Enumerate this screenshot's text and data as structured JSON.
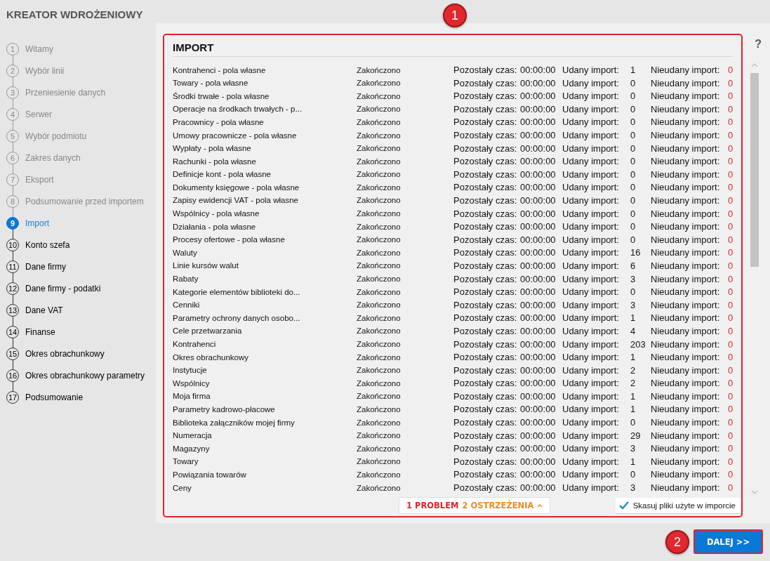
{
  "window": {
    "title": "KREATOR WDROŻENIOWY"
  },
  "steps": [
    {
      "number": "1",
      "label": "Witamy",
      "completed": true,
      "selected": false
    },
    {
      "number": "2",
      "label": "Wybór linii",
      "completed": true,
      "selected": false
    },
    {
      "number": "3",
      "label": "Przeniesienie danych",
      "completed": true,
      "selected": false
    },
    {
      "number": "4",
      "label": "Serwer",
      "completed": true,
      "selected": false
    },
    {
      "number": "5",
      "label": "Wybór podmiotu",
      "completed": true,
      "selected": false
    },
    {
      "number": "6",
      "label": "Zakres danych",
      "completed": true,
      "selected": false
    },
    {
      "number": "7",
      "label": "Eksport",
      "completed": true,
      "selected": false
    },
    {
      "number": "8",
      "label": "Podsumowanie przed importem",
      "completed": true,
      "selected": false
    },
    {
      "number": "9",
      "label": "Import",
      "completed": false,
      "selected": true
    },
    {
      "number": "10",
      "label": "Konto szefa",
      "completed": false,
      "selected": false
    },
    {
      "number": "11",
      "label": "Dane firmy",
      "completed": false,
      "selected": false
    },
    {
      "number": "12",
      "label": "Dane firmy - podatki",
      "completed": false,
      "selected": false
    },
    {
      "number": "13",
      "label": "Dane VAT",
      "completed": false,
      "selected": false
    },
    {
      "number": "14",
      "label": "Finanse",
      "completed": false,
      "selected": false
    },
    {
      "number": "15",
      "label": "Okres obrachunkowy",
      "completed": false,
      "selected": false
    },
    {
      "number": "16",
      "label": "Okres obrachunkowy parametry",
      "completed": false,
      "selected": false
    },
    {
      "number": "17",
      "label": "Podsumowanie",
      "completed": false,
      "selected": false
    }
  ],
  "panel": {
    "title": "IMPORT",
    "help": "?",
    "rows": [
      {
        "name": "Kontrahenci - pola własne",
        "status": "Zakończono",
        "remaining_label": "Pozostały czas:",
        "remaining": "00:00:00",
        "success_label": "Udany import:",
        "success": "1",
        "failed_label": "Nieudany import:",
        "failed": "0"
      },
      {
        "name": "Towary - pola własne",
        "status": "Zakończono",
        "remaining_label": "Pozostały czas:",
        "remaining": "00:00:00",
        "success_label": "Udany import:",
        "success": "0",
        "failed_label": "Nieudany import:",
        "failed": "0"
      },
      {
        "name": "Środki trwałe - pola własne",
        "status": "Zakończono",
        "remaining_label": "Pozostały czas:",
        "remaining": "00:00:00",
        "success_label": "Udany import:",
        "success": "0",
        "failed_label": "Nieudany import:",
        "failed": "0"
      },
      {
        "name": "Operacje na środkach trwałych - p...",
        "status": "Zakończono",
        "remaining_label": "Pozostały czas:",
        "remaining": "00:00:00",
        "success_label": "Udany import:",
        "success": "0",
        "failed_label": "Nieudany import:",
        "failed": "0"
      },
      {
        "name": "Pracownicy - pola własne",
        "status": "Zakończono",
        "remaining_label": "Pozostały czas:",
        "remaining": "00:00:00",
        "success_label": "Udany import:",
        "success": "0",
        "failed_label": "Nieudany import:",
        "failed": "0"
      },
      {
        "name": "Umowy pracownicze - pola własne",
        "status": "Zakończono",
        "remaining_label": "Pozostały czas:",
        "remaining": "00:00:00",
        "success_label": "Udany import:",
        "success": "0",
        "failed_label": "Nieudany import:",
        "failed": "0"
      },
      {
        "name": "Wypłaty - pola własne",
        "status": "Zakończono",
        "remaining_label": "Pozostały czas:",
        "remaining": "00:00:00",
        "success_label": "Udany import:",
        "success": "0",
        "failed_label": "Nieudany import:",
        "failed": "0"
      },
      {
        "name": "Rachunki - pola własne",
        "status": "Zakończono",
        "remaining_label": "Pozostały czas:",
        "remaining": "00:00:00",
        "success_label": "Udany import:",
        "success": "0",
        "failed_label": "Nieudany import:",
        "failed": "0"
      },
      {
        "name": "Definicje kont - pola własne",
        "status": "Zakończono",
        "remaining_label": "Pozostały czas:",
        "remaining": "00:00:00",
        "success_label": "Udany import:",
        "success": "0",
        "failed_label": "Nieudany import:",
        "failed": "0"
      },
      {
        "name": "Dokumenty księgowe - pola własne",
        "status": "Zakończono",
        "remaining_label": "Pozostały czas:",
        "remaining": "00:00:00",
        "success_label": "Udany import:",
        "success": "0",
        "failed_label": "Nieudany import:",
        "failed": "0"
      },
      {
        "name": "Zapisy ewidencji VAT - pola własne",
        "status": "Zakończono",
        "remaining_label": "Pozostały czas:",
        "remaining": "00:00:00",
        "success_label": "Udany import:",
        "success": "0",
        "failed_label": "Nieudany import:",
        "failed": "0"
      },
      {
        "name": "Wspólnicy - pola własne",
        "status": "Zakończono",
        "remaining_label": "Pozostały czas:",
        "remaining": "00:00:00",
        "success_label": "Udany import:",
        "success": "0",
        "failed_label": "Nieudany import:",
        "failed": "0"
      },
      {
        "name": "Działania - pola własne",
        "status": "Zakończono",
        "remaining_label": "Pozostały czas:",
        "remaining": "00:00:00",
        "success_label": "Udany import:",
        "success": "0",
        "failed_label": "Nieudany import:",
        "failed": "0"
      },
      {
        "name": "Procesy ofertowe - pola własne",
        "status": "Zakończono",
        "remaining_label": "Pozostały czas:",
        "remaining": "00:00:00",
        "success_label": "Udany import:",
        "success": "0",
        "failed_label": "Nieudany import:",
        "failed": "0"
      },
      {
        "name": "Waluty",
        "status": "Zakończono",
        "remaining_label": "Pozostały czas:",
        "remaining": "00:00:00",
        "success_label": "Udany import:",
        "success": "16",
        "failed_label": "Nieudany import:",
        "failed": "0"
      },
      {
        "name": "Linie kursów walut",
        "status": "Zakończono",
        "remaining_label": "Pozostały czas:",
        "remaining": "00:00:00",
        "success_label": "Udany import:",
        "success": "6",
        "failed_label": "Nieudany import:",
        "failed": "0"
      },
      {
        "name": "Rabaty",
        "status": "Zakończono",
        "remaining_label": "Pozostały czas:",
        "remaining": "00:00:00",
        "success_label": "Udany import:",
        "success": "3",
        "failed_label": "Nieudany import:",
        "failed": "0"
      },
      {
        "name": "Kategorie elementów biblioteki do...",
        "status": "Zakończono",
        "remaining_label": "Pozostały czas:",
        "remaining": "00:00:00",
        "success_label": "Udany import:",
        "success": "0",
        "failed_label": "Nieudany import:",
        "failed": "0"
      },
      {
        "name": "Cenniki",
        "status": "Zakończono",
        "remaining_label": "Pozostały czas:",
        "remaining": "00:00:00",
        "success_label": "Udany import:",
        "success": "3",
        "failed_label": "Nieudany import:",
        "failed": "0"
      },
      {
        "name": "Parametry ochrony danych osobo...",
        "status": "Zakończono",
        "remaining_label": "Pozostały czas:",
        "remaining": "00:00:00",
        "success_label": "Udany import:",
        "success": "1",
        "failed_label": "Nieudany import:",
        "failed": "0"
      },
      {
        "name": "Cele przetwarzania",
        "status": "Zakończono",
        "remaining_label": "Pozostały czas:",
        "remaining": "00:00:00",
        "success_label": "Udany import:",
        "success": "4",
        "failed_label": "Nieudany import:",
        "failed": "0"
      },
      {
        "name": "Kontrahenci",
        "status": "Zakończono",
        "remaining_label": "Pozostały czas:",
        "remaining": "00:00:00",
        "success_label": "Udany import:",
        "success": "203",
        "failed_label": "Nieudany import:",
        "failed": "0"
      },
      {
        "name": "Okres obrachunkowy",
        "status": "Zakończono",
        "remaining_label": "Pozostały czas:",
        "remaining": "00:00:00",
        "success_label": "Udany import:",
        "success": "1",
        "failed_label": "Nieudany import:",
        "failed": "0"
      },
      {
        "name": "Instytucje",
        "status": "Zakończono",
        "remaining_label": "Pozostały czas:",
        "remaining": "00:00:00",
        "success_label": "Udany import:",
        "success": "2",
        "failed_label": "Nieudany import:",
        "failed": "0"
      },
      {
        "name": "Wspólnicy",
        "status": "Zakończono",
        "remaining_label": "Pozostały czas:",
        "remaining": "00:00:00",
        "success_label": "Udany import:",
        "success": "2",
        "failed_label": "Nieudany import:",
        "failed": "0"
      },
      {
        "name": "Moja firma",
        "status": "Zakończono",
        "remaining_label": "Pozostały czas:",
        "remaining": "00:00:00",
        "success_label": "Udany import:",
        "success": "1",
        "failed_label": "Nieudany import:",
        "failed": "0"
      },
      {
        "name": "Parametry kadrowo-płacowe",
        "status": "Zakończono",
        "remaining_label": "Pozostały czas:",
        "remaining": "00:00:00",
        "success_label": "Udany import:",
        "success": "1",
        "failed_label": "Nieudany import:",
        "failed": "0"
      },
      {
        "name": "Biblioteka załączników mojej firmy",
        "status": "Zakończono",
        "remaining_label": "Pozostały czas:",
        "remaining": "00:00:00",
        "success_label": "Udany import:",
        "success": "0",
        "failed_label": "Nieudany import:",
        "failed": "0"
      },
      {
        "name": "Numeracja",
        "status": "Zakończono",
        "remaining_label": "Pozostały czas:",
        "remaining": "00:00:00",
        "success_label": "Udany import:",
        "success": "29",
        "failed_label": "Nieudany import:",
        "failed": "0"
      },
      {
        "name": "Magazyny",
        "status": "Zakończono",
        "remaining_label": "Pozostały czas:",
        "remaining": "00:00:00",
        "success_label": "Udany import:",
        "success": "3",
        "failed_label": "Nieudany import:",
        "failed": "0"
      },
      {
        "name": "Towary",
        "status": "Zakończono",
        "remaining_label": "Pozostały czas:",
        "remaining": "00:00:00",
        "success_label": "Udany import:",
        "success": "1",
        "failed_label": "Nieudany import:",
        "failed": "0"
      },
      {
        "name": "Powiązania towarów",
        "status": "Zakończono",
        "remaining_label": "Pozostały czas:",
        "remaining": "00:00:00",
        "success_label": "Udany import:",
        "success": "0",
        "failed_label": "Nieudany import:",
        "failed": "0"
      },
      {
        "name": "Ceny",
        "status": "Zakończono",
        "remaining_label": "Pozostały czas:",
        "remaining": "00:00:00",
        "success_label": "Udany import:",
        "success": "3",
        "failed_label": "Nieudany import:",
        "failed": "0"
      }
    ],
    "problems": {
      "errors": "1 PROBLEM",
      "warnings": "2 OSTRZEŻENIA"
    },
    "delete_files": {
      "label": "Skasuj pliki użyte w imporcie",
      "checked": true
    }
  },
  "next_button": "DALEJ >>",
  "annotations": [
    {
      "label": "1"
    },
    {
      "label": "2"
    }
  ]
}
